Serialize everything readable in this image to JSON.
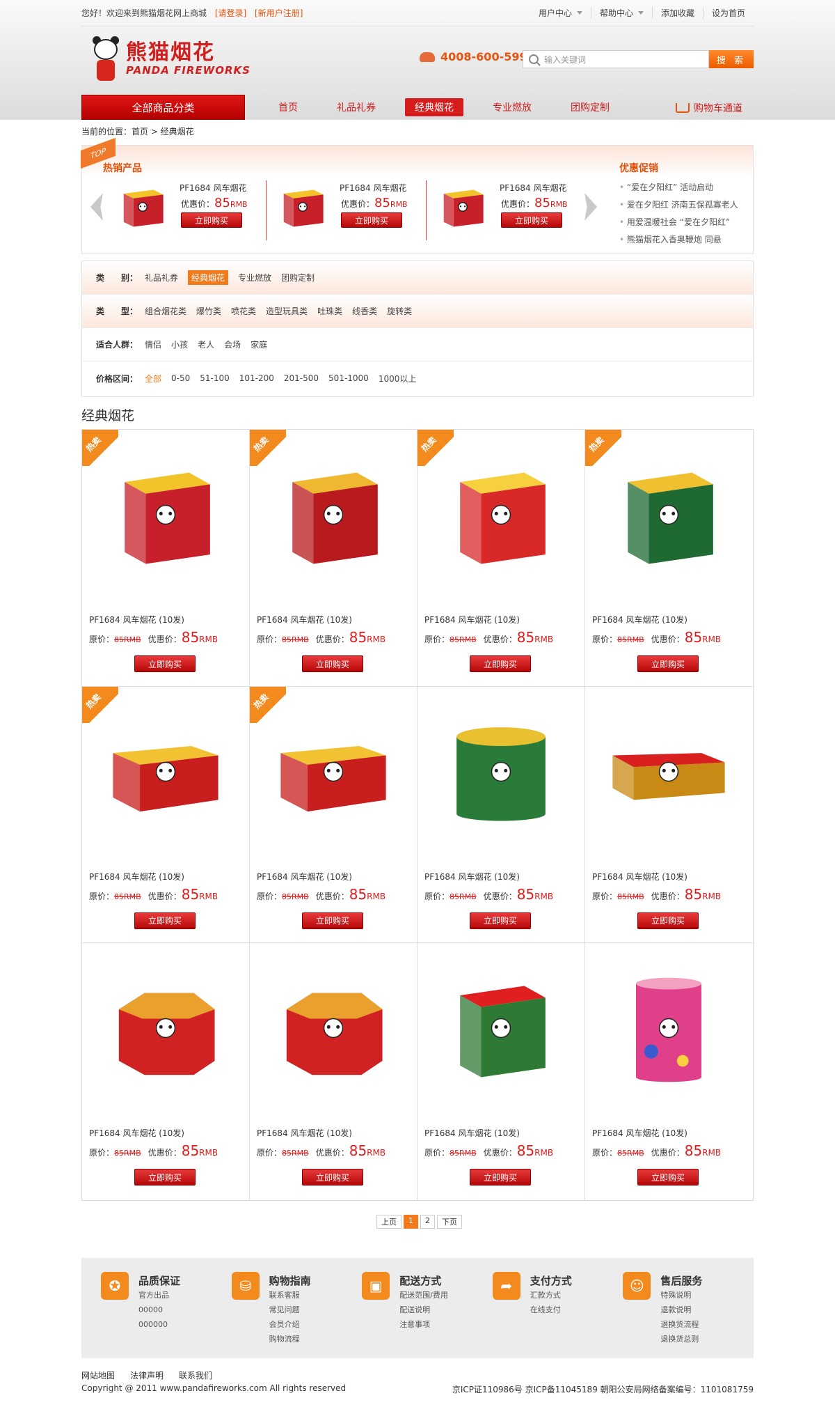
{
  "topbar": {
    "greeting": "您好！欢迎来到熊猫烟花网上商城",
    "login": "[请登录]",
    "register": "[新用户注册]",
    "links": [
      "用户中心",
      "帮助中心",
      "添加收藏",
      "设为首页"
    ]
  },
  "logo": {
    "cn": "熊猫烟花",
    "en": "PANDA FIREWORKS"
  },
  "phone": "4008-600-599",
  "search": {
    "placeholder": "输入关键词",
    "button": "搜 索"
  },
  "nav": {
    "all": "全部商品分类",
    "items": [
      "首页",
      "礼品礼券",
      "经典烟花",
      "专业燃放",
      "团购定制"
    ],
    "active": 2,
    "cart": "购物车通道"
  },
  "breadcrumb": "当前的位置：首页 > 经典烟花",
  "top": {
    "tag": "TOP",
    "title": "热销产品",
    "promo_title": "优惠促销",
    "products": [
      {
        "name": "PF1684 风车烟花",
        "price_label": "优惠价：",
        "price": "85",
        "unit": "RMB",
        "buy": "立即购买"
      },
      {
        "name": "PF1684 风车烟花",
        "price_label": "优惠价：",
        "price": "85",
        "unit": "RMB",
        "buy": "立即购买"
      },
      {
        "name": "PF1684 风车烟花",
        "price_label": "优惠价：",
        "price": "85",
        "unit": "RMB",
        "buy": "立即购买"
      }
    ],
    "promos": [
      "“爱在夕阳红” 活动启动",
      "爱在夕阳红  济南五保孤寡老人",
      "用爱温暖社会  “爱在夕阳红”",
      "熊猫烟花入香奥鞭炮  同悬"
    ]
  },
  "filters": [
    {
      "label": "类　　别：",
      "items": [
        "礼品礼券",
        "经典烟花",
        "专业燃放",
        "团购定制"
      ],
      "selected": 1
    },
    {
      "label": "类　　型：",
      "items": [
        "组合烟花类",
        "爆竹类",
        "喷花类",
        "造型玩具类",
        "吐珠类",
        "线香类",
        "旋转类"
      ],
      "selected": -1
    },
    {
      "label": "适合人群：",
      "items": [
        "情侣",
        "小孩",
        "老人",
        "会场",
        "家庭"
      ],
      "selected": -1
    },
    {
      "label": "价格区间：",
      "items": [
        "全部",
        "0-50",
        "51-100",
        "101-200",
        "201-500",
        "501-1000",
        "1000以上"
      ],
      "selected": -1,
      "orange": 0
    }
  ],
  "section_title": "经典烟花",
  "hot_label": "热卖",
  "products": [
    {
      "name": "PF1684 风车烟花 (10发)",
      "orig_label": "原价：",
      "orig": "85RMB",
      "price_label": "优惠价：",
      "price": "85",
      "unit": "RMB",
      "buy": "立即购买",
      "hot": true,
      "color": "#c8202a",
      "accent": "#f3c42a",
      "shape": "box",
      "art": "步步高"
    },
    {
      "name": "PF1684 风车烟花 (10发)",
      "orig_label": "原价：",
      "orig": "85RMB",
      "price_label": "优惠价：",
      "price": "85",
      "unit": "RMB",
      "buy": "立即购买",
      "hot": true,
      "color": "#b81a1e",
      "accent": "#f0b830",
      "shape": "box",
      "art": "喜庆中华"
    },
    {
      "name": "PF1684 风车烟花 (10发)",
      "orig_label": "原价：",
      "orig": "85RMB",
      "price_label": "优惠价：",
      "price": "85",
      "unit": "RMB",
      "buy": "立即购买",
      "hot": true,
      "color": "#d82828",
      "accent": "#f7d040",
      "shape": "box",
      "art": "四季发财"
    },
    {
      "name": "PF1684 风车烟花 (10发)",
      "orig_label": "原价：",
      "orig": "85RMB",
      "price_label": "优惠价：",
      "price": "85",
      "unit": "RMB",
      "buy": "立即购买",
      "hot": true,
      "color": "#1e6a32",
      "accent": "#f0c030",
      "shape": "box",
      "art": "四季发财"
    },
    {
      "name": "PF1684 风车烟花 (10发)",
      "orig_label": "原价：",
      "orig": "85RMB",
      "price_label": "优惠价：",
      "price": "85",
      "unit": "RMB",
      "buy": "立即购买",
      "hot": true,
      "color": "#c81e1e",
      "accent": "#f2c232",
      "shape": "wide",
      "art": "中国力量"
    },
    {
      "name": "PF1684 风车烟花 (10发)",
      "orig_label": "原价：",
      "orig": "85RMB",
      "price_label": "优惠价：",
      "price": "85",
      "unit": "RMB",
      "buy": "立即购买",
      "hot": true,
      "color": "#c81e1e",
      "accent": "#f2c232",
      "shape": "wide",
      "art": "中国力量"
    },
    {
      "name": "PF1684 风车烟花 (10发)",
      "orig_label": "原价：",
      "orig": "85RMB",
      "price_label": "优惠价：",
      "price": "85",
      "unit": "RMB",
      "buy": "立即购买",
      "hot": false,
      "color": "#2a7a3a",
      "accent": "#e8c030",
      "shape": "drum",
      "art": "七叶金花"
    },
    {
      "name": "PF1684 风车烟花 (10发)",
      "orig_label": "原价：",
      "orig": "85RMB",
      "price_label": "优惠价：",
      "price": "85",
      "unit": "RMB",
      "buy": "立即购买",
      "hot": false,
      "color": "#c88a14",
      "accent": "#d82020",
      "shape": "flat",
      "art": "金闪瀑布"
    },
    {
      "name": "PF1684 风车烟花 (10发)",
      "orig_label": "原价：",
      "orig": "85RMB",
      "price_label": "优惠价：",
      "price": "85",
      "unit": "RMB",
      "buy": "立即购买",
      "hot": false,
      "color": "#d02222",
      "accent": "#f0c030",
      "shape": "hex",
      "art": "熊猫力量"
    },
    {
      "name": "PF1684 风车烟花 (10发)",
      "orig_label": "原价：",
      "orig": "85RMB",
      "price_label": "优惠价：",
      "price": "85",
      "unit": "RMB",
      "buy": "立即购买",
      "hot": false,
      "color": "#d02222",
      "accent": "#f0c030",
      "shape": "hex",
      "art": "熊猫力量"
    },
    {
      "name": "PF1684 风车烟花 (10发)",
      "orig_label": "原价：",
      "orig": "85RMB",
      "price_label": "优惠价：",
      "price": "85",
      "unit": "RMB",
      "buy": "立即购买",
      "hot": false,
      "color": "#2e7a34",
      "accent": "#e02020",
      "shape": "box",
      "art": "快乐"
    },
    {
      "name": "PF1684 风车烟花 (10发)",
      "orig_label": "原价：",
      "orig": "85RMB",
      "price_label": "优惠价：",
      "price": "85",
      "unit": "RMB",
      "buy": "立即购买",
      "hot": false,
      "color": "#e0408a",
      "accent": "#3a5ad0",
      "shape": "tall",
      "art": "快乐"
    }
  ],
  "pager": {
    "prev": "上页",
    "pages": [
      "1",
      "2"
    ],
    "current": 0,
    "next": "下页"
  },
  "services": [
    {
      "icon": "shield-icon",
      "title": "品质保证",
      "lines": [
        "官方出品",
        "00000",
        "000000"
      ]
    },
    {
      "icon": "basket-icon",
      "title": "购物指南",
      "lines": [
        "联系客服",
        "常见问题",
        "会员介绍",
        "购物流程"
      ]
    },
    {
      "icon": "truck-icon",
      "title": "配送方式",
      "lines": [
        "配送范围/费用",
        "配送说明",
        "注意事项"
      ]
    },
    {
      "icon": "share-arrow-icon",
      "title": "支付方式",
      "lines": [
        "汇款方式",
        "在线支付"
      ]
    },
    {
      "icon": "smile-icon",
      "title": "售后服务",
      "lines": [
        "特殊说明",
        "退款说明",
        "退换货流程",
        "退换货总则"
      ]
    }
  ],
  "footer": {
    "links": [
      "网站地图",
      "法律声明",
      "联系我们"
    ],
    "copyright": "Copyright @ 2011 www.pandafireworks.com All rights reserved",
    "icp": "京ICP证110986号 京ICP备11045189  朝阳公安局网络备案编号：1101081759"
  }
}
